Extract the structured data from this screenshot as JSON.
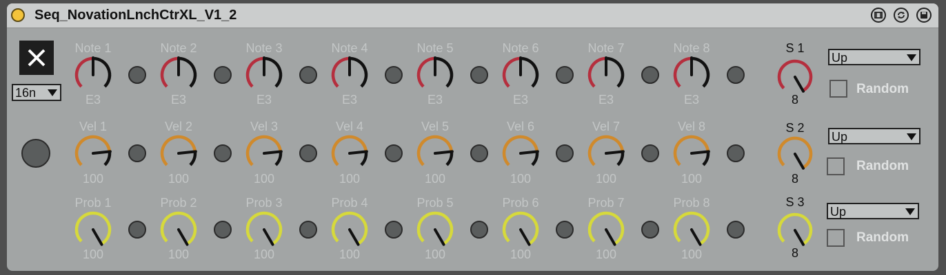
{
  "device": {
    "title": "Seq_NovationLnchCtrXL_V1_2",
    "rate": "16n",
    "colors": {
      "note": "#b52f3e",
      "vel": "#d08a2c",
      "prob": "#d6d93c",
      "track": "#9a9d9d",
      "indicator": "#111111"
    }
  },
  "rows": [
    {
      "kind": "note",
      "knobs": [
        {
          "label": "Note 1",
          "value": "E3"
        },
        {
          "label": "Note 2",
          "value": "E3"
        },
        {
          "label": "Note 3",
          "value": "E3"
        },
        {
          "label": "Note 4",
          "value": "E3"
        },
        {
          "label": "Note 5",
          "value": "E3"
        },
        {
          "label": "Note 6",
          "value": "E3"
        },
        {
          "label": "Note 7",
          "value": "E3"
        },
        {
          "label": "Note 8",
          "value": "E3"
        }
      ],
      "steps": {
        "label": "S 1",
        "value": "8"
      },
      "direction": "Up",
      "random_label": "Random"
    },
    {
      "kind": "vel",
      "knobs": [
        {
          "label": "Vel 1",
          "value": "100"
        },
        {
          "label": "Vel 2",
          "value": "100"
        },
        {
          "label": "Vel 3",
          "value": "100"
        },
        {
          "label": "Vel 4",
          "value": "100"
        },
        {
          "label": "Vel 5",
          "value": "100"
        },
        {
          "label": "Vel 6",
          "value": "100"
        },
        {
          "label": "Vel 7",
          "value": "100"
        },
        {
          "label": "Vel 8",
          "value": "100"
        }
      ],
      "steps": {
        "label": "S 2",
        "value": "8"
      },
      "direction": "Up",
      "random_label": "Random"
    },
    {
      "kind": "prob",
      "knobs": [
        {
          "label": "Prob 1",
          "value": "100"
        },
        {
          "label": "Prob 2",
          "value": "100"
        },
        {
          "label": "Prob 3",
          "value": "100"
        },
        {
          "label": "Prob 4",
          "value": "100"
        },
        {
          "label": "Prob 5",
          "value": "100"
        },
        {
          "label": "Prob 6",
          "value": "100"
        },
        {
          "label": "Prob 7",
          "value": "100"
        },
        {
          "label": "Prob 8",
          "value": "100"
        }
      ],
      "steps": {
        "label": "S 3",
        "value": "8"
      },
      "direction": "Up",
      "random_label": "Random"
    }
  ]
}
